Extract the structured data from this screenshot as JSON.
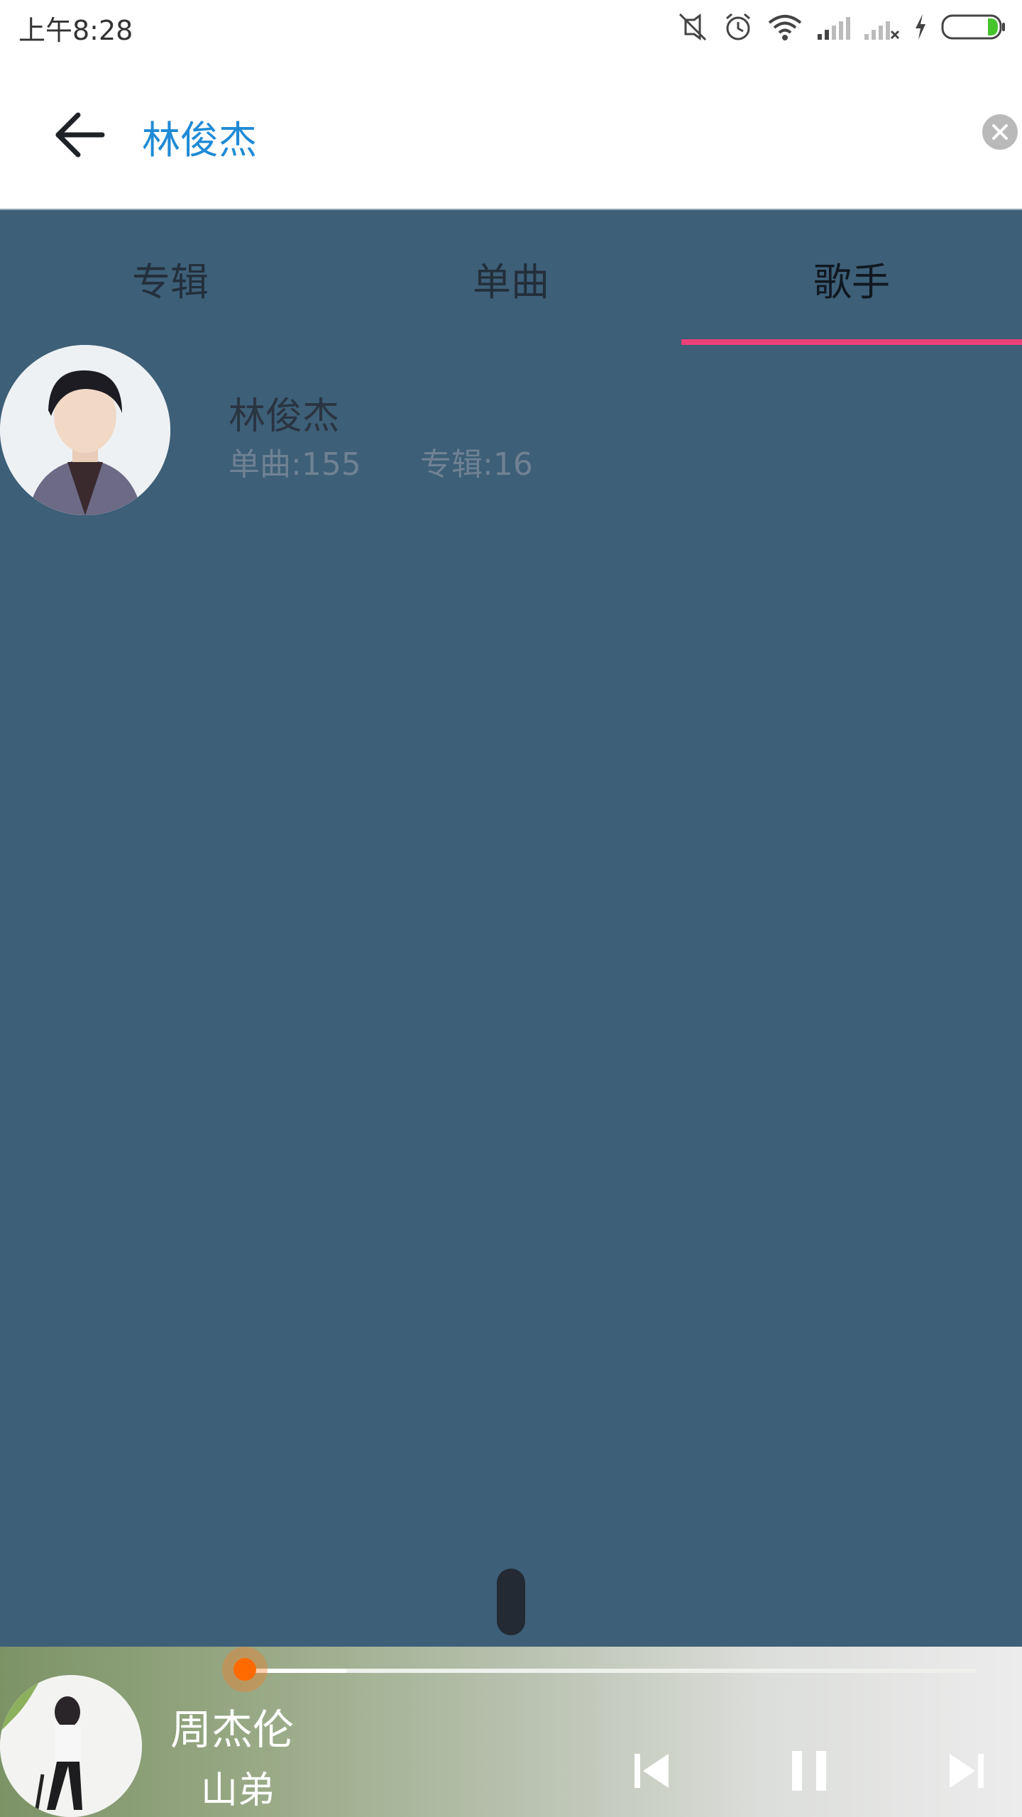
{
  "status_bar": {
    "time": "上午8:28"
  },
  "search": {
    "query": "林俊杰"
  },
  "tabs": [
    {
      "label": "专辑",
      "active": false
    },
    {
      "label": "单曲",
      "active": false
    },
    {
      "label": "歌手",
      "active": true
    }
  ],
  "artist": {
    "name": "林俊杰",
    "singles": "单曲:155",
    "albums": "专辑:16"
  },
  "player": {
    "artist": "周杰伦",
    "song": "山弟",
    "progress": 0.14
  },
  "colors": {
    "accent": "#1f8ad6",
    "tab_indicator": "#ec407a",
    "background": "#3d5f78",
    "progress_thumb": "#ff6a00"
  },
  "icons": [
    "back-arrow-icon",
    "clear-icon",
    "previous-icon",
    "pause-icon",
    "next-icon",
    "mute-icon",
    "alarm-icon",
    "wifi-icon",
    "signal-icon",
    "charging-icon",
    "battery-icon"
  ]
}
